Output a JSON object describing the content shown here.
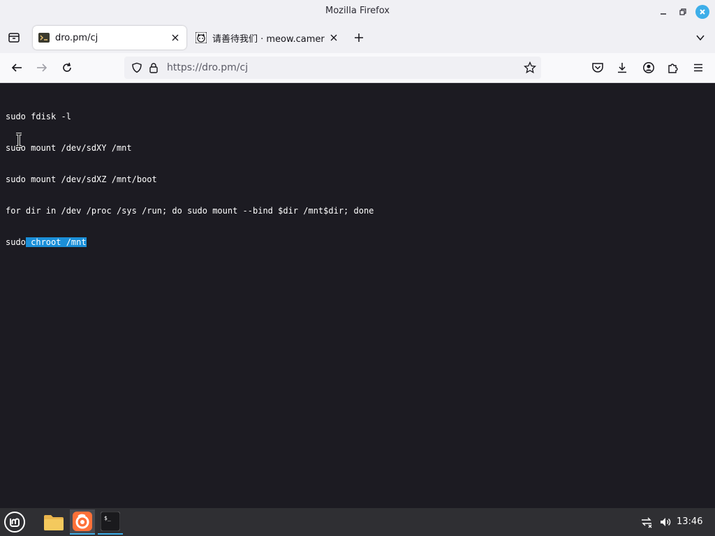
{
  "window": {
    "title": "Mozilla Firefox"
  },
  "tabs": [
    {
      "label": "dro.pm/cj",
      "active": true
    },
    {
      "label": "请善待我们 · meow.camera",
      "active": false
    }
  ],
  "navbar": {
    "url": "https://dro.pm/cj"
  },
  "terminal": {
    "lines": [
      "sudo fdisk -l",
      "sudo mount /dev/sdXY /mnt",
      "sudo mount /dev/sdXZ /mnt/boot",
      "for dir in /dev /proc /sys /run; do sudo mount --bind $dir /mnt$dir; done"
    ],
    "last_line_plain": "sudo",
    "last_line_selected": " chroot /mnt"
  },
  "taskbar": {
    "clock": "13:46"
  },
  "colors": {
    "accent": "#3daee9",
    "selection": "#1b8fd8",
    "content_bg": "#1c1b22",
    "firefox_orange": "#ff7139"
  }
}
